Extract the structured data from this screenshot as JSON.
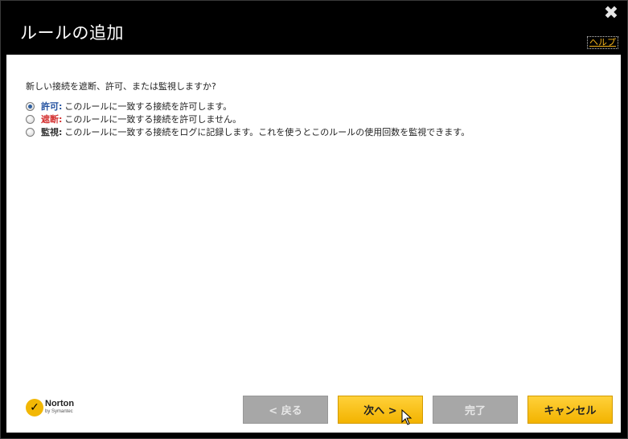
{
  "dialog": {
    "title": "ルールの追加",
    "help_label": "ヘルプ",
    "close_glyph": "✖"
  },
  "content": {
    "question": "新しい接続を遮断、許可、または監視しますか?",
    "options": [
      {
        "keyword": "許可:",
        "text": "このルールに一致する接続を許可します。",
        "selected": true
      },
      {
        "keyword": "遮断:",
        "text": "このルールに一致する接続を許可しません。",
        "selected": false
      },
      {
        "keyword": "監視:",
        "text": "このルールに一致する接続をログに記録します。これを使うとこのルールの使用回数を監視できます。",
        "selected": false
      }
    ]
  },
  "logo": {
    "name": "Norton",
    "sub": "by Symantec",
    "mark_glyph": "✓",
    "icon": "norton-check-icon"
  },
  "buttons": {
    "back": "< 戻る",
    "next": "次へ >",
    "finish": "完了",
    "cancel": "キャンセル"
  },
  "colors": {
    "accent_yellow": "#f3b300",
    "allow_blue": "#1f4e9e",
    "block_red": "#d22b2b",
    "disabled_gray": "#a7a7a7"
  }
}
